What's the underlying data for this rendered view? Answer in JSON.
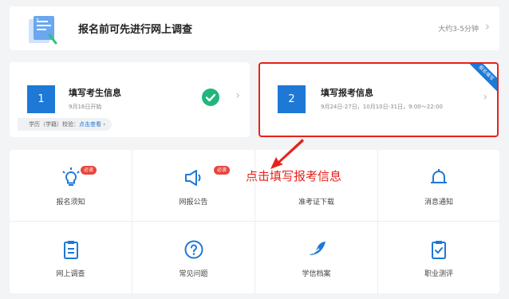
{
  "survey": {
    "title": "报名前可先进行网上调查",
    "duration": "大约3-5分钟"
  },
  "steps": [
    {
      "number": "1",
      "title": "填写考生信息",
      "date": "9月16日开始",
      "verify_label": "学历（学籍）校验：",
      "verify_link": "点击查看"
    },
    {
      "number": "2",
      "title": "填写报考信息",
      "date": "9月24日-27日，10月10日-31日，9:00～22:00",
      "ribbon": "报名填写"
    }
  ],
  "grid": [
    {
      "label": "报名须知",
      "icon": "bulb-icon",
      "badge": "必读"
    },
    {
      "label": "网报公告",
      "icon": "megaphone-icon",
      "badge": "必读"
    },
    {
      "label": "准考证下载",
      "icon": "download-icon",
      "badge": ""
    },
    {
      "label": "消息通知",
      "icon": "bell-icon",
      "badge": ""
    },
    {
      "label": "网上调查",
      "icon": "clipboard-icon",
      "badge": ""
    },
    {
      "label": "常见问题",
      "icon": "question-icon",
      "badge": ""
    },
    {
      "label": "学信档案",
      "icon": "feather-icon",
      "badge": ""
    },
    {
      "label": "职业测评",
      "icon": "checklist-icon",
      "badge": ""
    }
  ],
  "annotation": "点击填写报考信息",
  "colors": {
    "accent": "#1e78d6",
    "highlight": "#e8221a",
    "success": "#1fb77c"
  }
}
